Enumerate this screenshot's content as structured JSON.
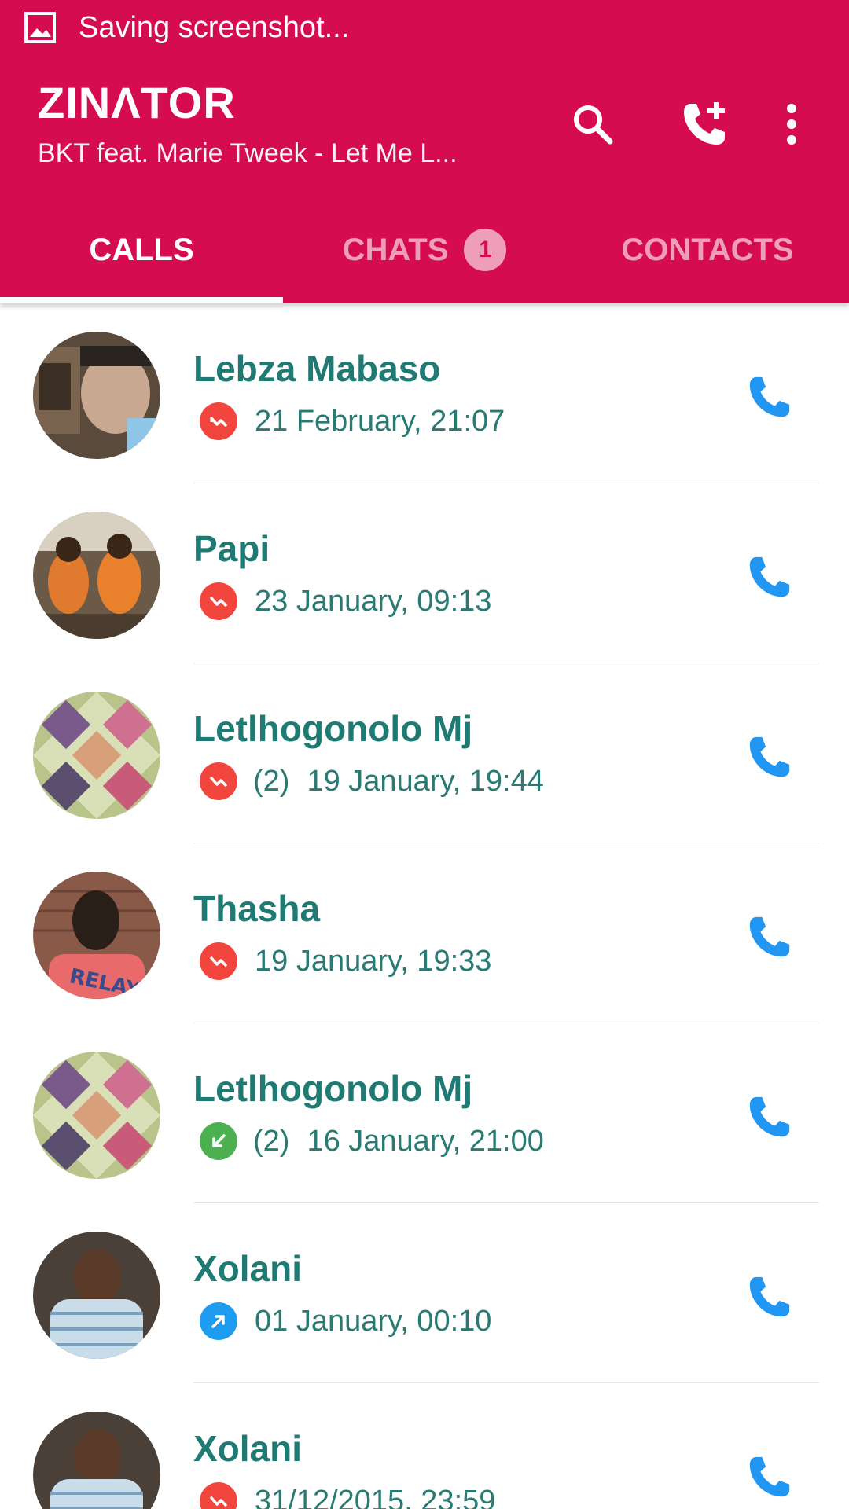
{
  "status_bar": {
    "icon": "image-icon",
    "text": "Saving screenshot..."
  },
  "app_bar": {
    "title": "ZINΛTOR",
    "subtitle": "BKT feat. Marie Tweek - Let Me L...",
    "actions": [
      "search-icon",
      "add-call-icon",
      "more-vert-icon"
    ]
  },
  "tabs": [
    {
      "label": "CALLS",
      "active": true
    },
    {
      "label": "CHATS",
      "badge": "1",
      "active": false
    },
    {
      "label": "CONTACTS",
      "active": false
    }
  ],
  "colors": {
    "primary": "#D50D50",
    "name_text": "#1E7A72",
    "missed": "#F2453D",
    "incoming": "#4CAF50",
    "outgoing": "#1E9CF0",
    "call_button": "#2196F3"
  },
  "calls": [
    {
      "name": "Lebza Mabaso",
      "type": "missed",
      "count": "",
      "time": "21 February, 21:07"
    },
    {
      "name": "Papi",
      "type": "missed",
      "count": "",
      "time": "23 January, 09:13"
    },
    {
      "name": "Letlhogonolo Mj",
      "type": "missed",
      "count": "(2)",
      "time": "19 January, 19:44"
    },
    {
      "name": "Thasha",
      "type": "missed",
      "count": "",
      "time": "19 January, 19:33"
    },
    {
      "name": "Letlhogonolo Mj",
      "type": "incoming",
      "count": "(2)",
      "time": "16 January, 21:00"
    },
    {
      "name": "Xolani",
      "type": "outgoing",
      "count": "",
      "time": "01 January, 00:10"
    },
    {
      "name": "Xolani",
      "type": "missed",
      "count": "",
      "time": "31/12/2015, 23:59"
    }
  ]
}
